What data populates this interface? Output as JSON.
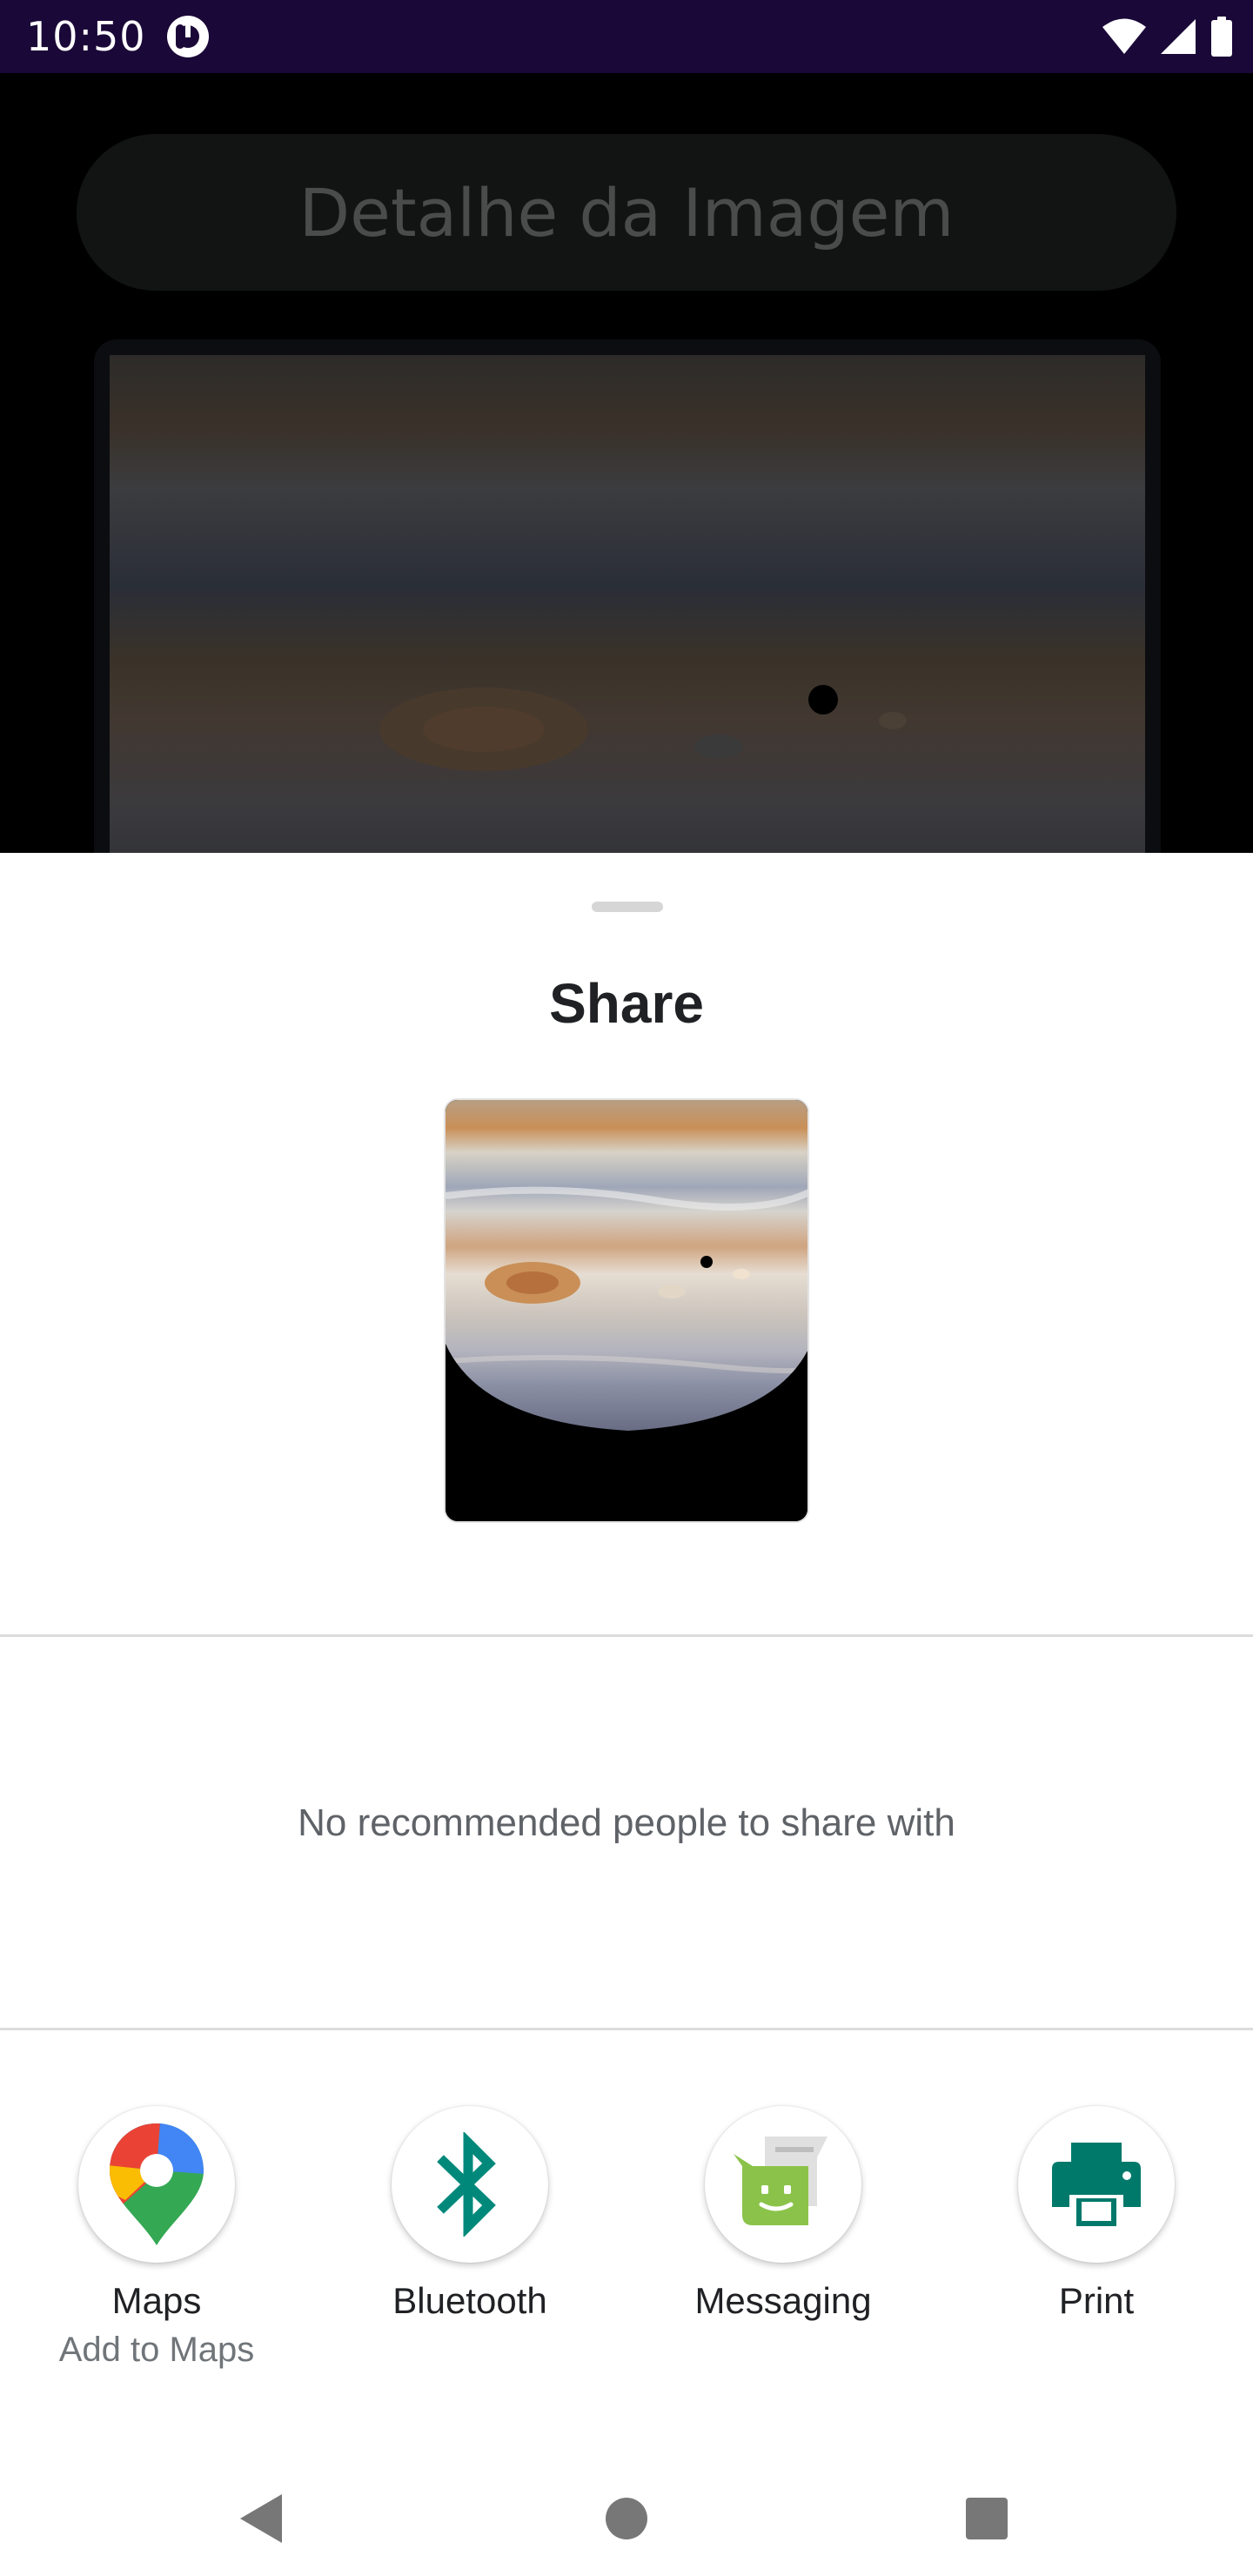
{
  "status_bar": {
    "time": "10:50",
    "icons": [
      "app-notification-icon",
      "wifi-icon",
      "signal-icon",
      "battery-icon"
    ]
  },
  "app": {
    "title": "Detalhe da Imagem"
  },
  "share_sheet": {
    "title": "Share",
    "no_people_text": "No recommended people to share with",
    "targets": [
      {
        "label": "Maps",
        "sublabel": "Add to Maps",
        "icon": "google-maps-icon"
      },
      {
        "label": "Bluetooth",
        "sublabel": "",
        "icon": "bluetooth-icon"
      },
      {
        "label": "Messaging",
        "sublabel": "",
        "icon": "messaging-icon"
      },
      {
        "label": "Print",
        "sublabel": "",
        "icon": "print-icon"
      }
    ]
  },
  "nav_bar": {
    "buttons": [
      "back-icon",
      "home-icon",
      "recents-icon"
    ]
  },
  "colors": {
    "status_bar_bg": "#1a0838",
    "bluetooth_teal": "#00897b",
    "print_teal": "#00796b",
    "messaging_green": "#8bc34a"
  }
}
